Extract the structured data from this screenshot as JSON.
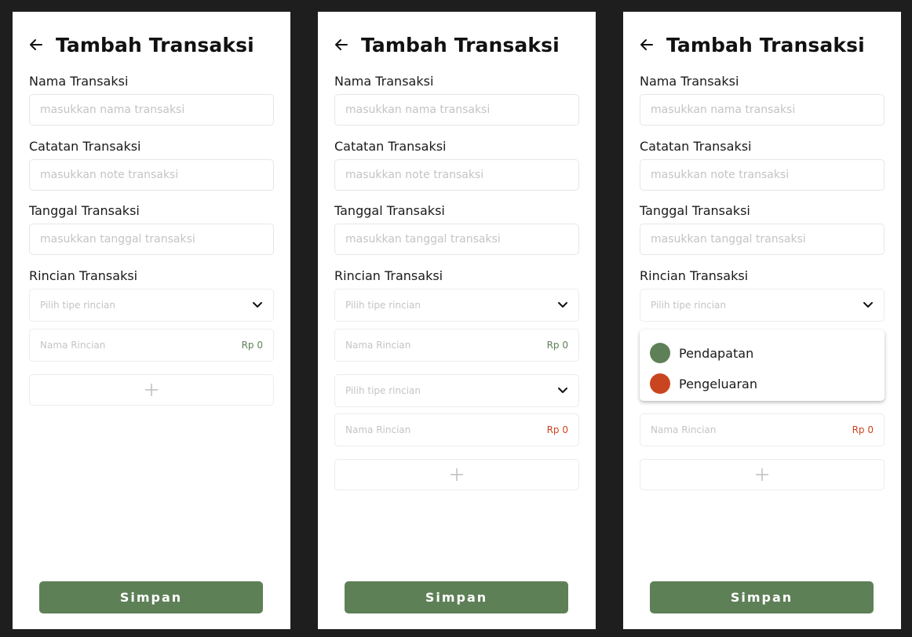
{
  "title": "Tambah Transaksi",
  "fields": {
    "name_label": "Nama Transaksi",
    "name_placeholder": "masukkan nama transaksi",
    "note_label": "Catatan Transaksi",
    "note_placeholder": "masukkan note transaksi",
    "date_label": "Tanggal Transaksi",
    "date_placeholder": "masukkan tanggal transaksi",
    "details_label": "Rincian Transaksi"
  },
  "detail": {
    "type_placeholder": "Pilih tipe rincian",
    "name_placeholder": "Nama Rincian",
    "amount": "Rp 0"
  },
  "dropdown_options": [
    "Pendapatan",
    "Pengeluaran"
  ],
  "save_label": "Simpan",
  "colors": {
    "primary": "#5e8057",
    "income": "#5e8057",
    "expense": "#c9451f",
    "placeholder": "#c4c4c4"
  },
  "icons": {
    "back": "arrow-left-icon",
    "dropdown": "chevron-down-icon",
    "add": "plus-icon"
  }
}
